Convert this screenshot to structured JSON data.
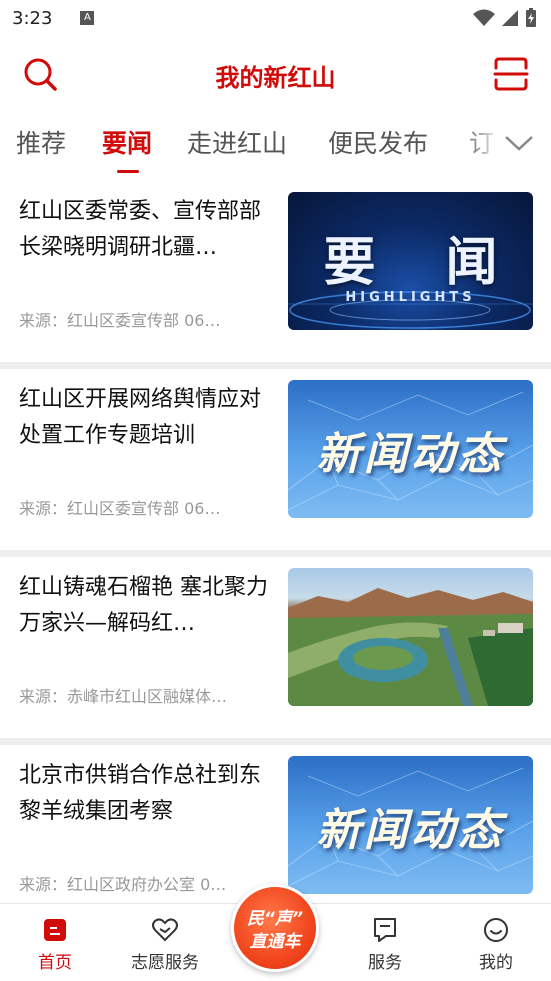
{
  "status_bar": {
    "time": "3:23",
    "notification_icon": "a-badge-icon",
    "right_icons": [
      "wifi-icon",
      "signal-icon",
      "battery-charging-icon"
    ]
  },
  "header": {
    "title": "我的新红山",
    "left_icon": "search-icon",
    "right_icon": "scan-icon",
    "accent_color": "#d10a0a"
  },
  "tabs": {
    "items": [
      {
        "label": "推荐",
        "active": false
      },
      {
        "label": "要闻",
        "active": true
      },
      {
        "label": "走进红山",
        "active": false
      },
      {
        "label": "便民发布",
        "active": false
      },
      {
        "label": "订",
        "active": false
      }
    ],
    "more_icon": "chevron-down-icon"
  },
  "news": [
    {
      "title": "红山区委常委、宣传部部长梁晓明调研北疆…",
      "meta": "来源：红山区委宣传部  06…",
      "thumb": {
        "type": "highlights",
        "big": "要 闻",
        "sub": "HIGHLIGHTS"
      }
    },
    {
      "title": "红山区开展网络舆情应对处置工作专题培训",
      "meta": "来源：红山区委宣传部  06…",
      "thumb": {
        "type": "dynamic",
        "big": "新闻动态"
      }
    },
    {
      "title": "红山铸魂石榴艳  塞北聚力万家兴—解码红…",
      "meta": "来源：赤峰市红山区融媒体…",
      "thumb": {
        "type": "landscape"
      }
    },
    {
      "title": "北京市供销合作总社到东黎羊绒集团考察",
      "meta": "来源：红山区政府办公室  0…",
      "thumb": {
        "type": "dynamic",
        "big": "新闻动态"
      }
    }
  ],
  "bottom_nav": {
    "items": [
      {
        "label": "首页",
        "icon": "home-icon",
        "active": true
      },
      {
        "label": "志愿服务",
        "icon": "volunteer-heart-icon",
        "active": false
      },
      {
        "label": "服务",
        "icon": "service-flag-icon",
        "active": false
      },
      {
        "label": "我的",
        "icon": "profile-smile-icon",
        "active": false
      }
    ],
    "center_button": {
      "line1": "民“声”",
      "line2": "直通车"
    }
  }
}
